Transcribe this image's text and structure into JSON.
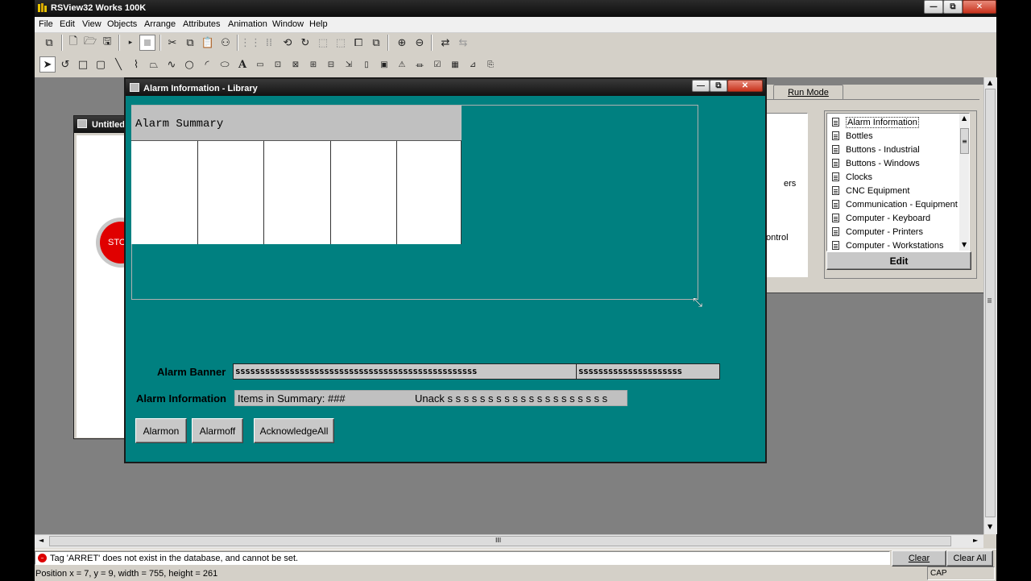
{
  "app": {
    "title": "RSView32 Works 100K",
    "window_controls": {
      "minimize": "—",
      "restore": "⧉",
      "close": "✕"
    }
  },
  "menu": [
    "File",
    "Edit",
    "View",
    "Objects",
    "Arrange",
    "Attributes",
    "Animation",
    "Window",
    "Help"
  ],
  "toolbar1_icons": [
    "new-display-icon",
    "new-file-icon",
    "open-icon",
    "save-icon",
    "run-icon",
    "stop-icon",
    "cut-icon",
    "copy-icon",
    "paste-icon",
    "duplicate-icon",
    "grid-icon",
    "snap-icon",
    "object-smart-path-icon",
    "rotate-icon",
    "align-icon",
    "group-icon",
    "ungroup-icon",
    "bring-front-icon",
    "send-back-icon",
    "zoom-in-icon",
    "zoom-out-icon",
    "flip-icon",
    "swap-icon"
  ],
  "toolbar2_icons": [
    "select-icon",
    "rotate-tool-icon",
    "rectangle-icon",
    "rounded-rect-icon",
    "line-icon",
    "polyline-icon",
    "polygon-icon",
    "freehand-icon",
    "ellipse-icon",
    "arc-icon",
    "wedge-icon",
    "text-icon",
    "button-icon",
    "numeric-input-icon",
    "string-display-icon",
    "numeric-display-icon",
    "recipe-icon",
    "arrow-icon",
    "panel-icon",
    "bitmap-icon",
    "alarm-icon",
    "trend-icon",
    "activex-icon",
    "ole-icon"
  ],
  "text_tool_glyph": "A",
  "untitled_window": {
    "title": "Untitled",
    "stop_label": "STO"
  },
  "right_panel": {
    "run_mode_tab": "Run Mode",
    "left_list_partial": [
      "ers",
      "ontrol"
    ],
    "library_items": [
      "Alarm Information",
      "Bottles",
      "Buttons - Industrial",
      "Buttons - Windows",
      "Clocks",
      "CNC Equipment",
      "Communication - Equipment",
      "Computer - Keyboard",
      "Computer - Printers",
      "Computer - Workstations"
    ],
    "selected_item": "Alarm Information",
    "edit_button": "Edit",
    "scroll_up": "▲",
    "scroll_down": "▼",
    "scroll_grip": "≡"
  },
  "library_window": {
    "title": "Alarm Information - Library",
    "alarm_summary_title": "Alarm Summary",
    "alarm_banner_label": "Alarm Banner",
    "alarm_banner_text_1": "sssssssssssssssssssssssssssssssssssssssssssssssss",
    "alarm_banner_text_2": "sssssssssssssssssssss",
    "alarm_information_label": "Alarm Information",
    "items_in_summary": "Items in Summary:  ###",
    "unack": "Unack  s s s s s s s s s s s s s s s s s s s s",
    "buttons": [
      "Alarmon",
      "Alarmoff",
      "AcknowledgeAll"
    ],
    "teal_color": "#008080",
    "resize_cursor": "⤡"
  },
  "scrollbars": {
    "left": "◄",
    "right": "►",
    "up": "▲",
    "down": "▼",
    "h_grip": "III",
    "v_grip": "III"
  },
  "status": {
    "message": "Tag 'ARRET' does not exist in the database, and cannot be set.",
    "clear": "Clear",
    "clear_all": "Clear All",
    "position": "Position x = 7, y = 9, width = 755, height = 261",
    "cap": "CAP"
  }
}
